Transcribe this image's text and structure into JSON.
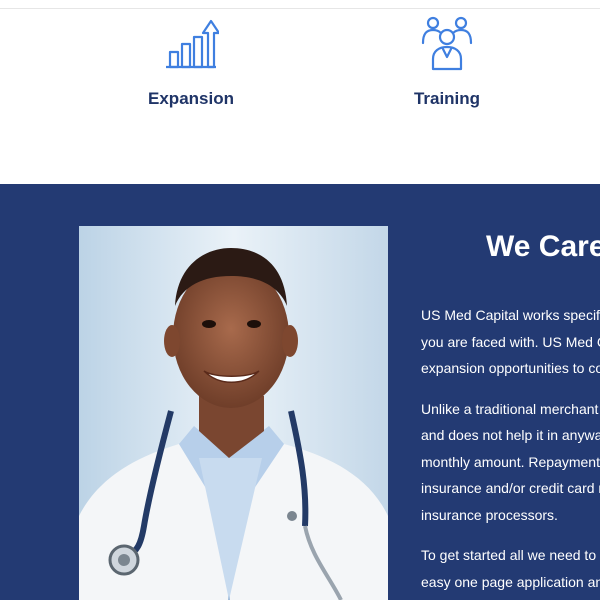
{
  "features": [
    {
      "title": "Expansion",
      "icon": "growth-chart-icon"
    },
    {
      "title": "Training",
      "icon": "team-icon"
    }
  ],
  "about": {
    "heading": "We Care",
    "paragraphs": [
      [
        "US Med Capital works specifica",
        "you are faced with. US Med C",
        "expansion opportunities to co"
      ],
      [
        "Unlike a traditional merchant",
        "and does not help it in anyway",
        "monthly amount. Repayment",
        "insurance and/or credit card r",
        "insurance processors."
      ],
      [
        "To get started all we need to",
        "easy one page application an"
      ]
    ]
  },
  "photo": {
    "subject": "doctor-photo"
  },
  "colors": {
    "navy": "#233a73",
    "icon_blue": "#3f7fe0",
    "title_navy": "#1f3467",
    "white": "#ffffff"
  }
}
